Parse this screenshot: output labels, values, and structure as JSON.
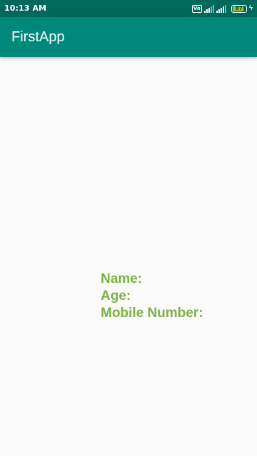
{
  "status_bar": {
    "time": "10:13 AM",
    "volte_badge": "Vo",
    "battery_level": "87",
    "icons": [
      "volte-icon",
      "signal-icon",
      "signal-icon",
      "battery-icon",
      "charging-icon"
    ]
  },
  "app_bar": {
    "title": "FirstApp"
  },
  "content": {
    "name_label": "Name:",
    "age_label": "Age:",
    "mobile_label": "Mobile Number:"
  },
  "colors": {
    "status_bar_bg": "#00695c",
    "app_bar_bg": "#00897b",
    "label_text": "#7cb342",
    "background": "#fafafa"
  }
}
